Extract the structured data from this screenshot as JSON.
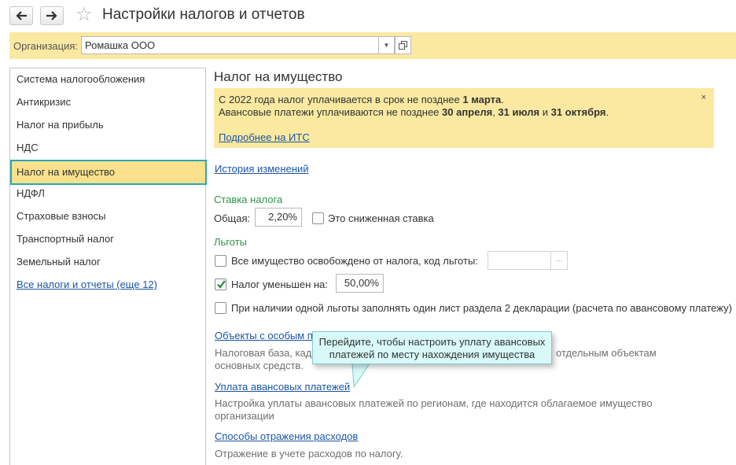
{
  "window": {
    "title": "Настройки налогов и отчетов",
    "back_icon": "arrow-left-icon",
    "forward_icon": "arrow-right-icon",
    "favorite_icon": "star-icon"
  },
  "organization": {
    "label": "Организация:",
    "value": "Ромашка ООО"
  },
  "sidebar": {
    "items": [
      {
        "label": "Система налогообложения"
      },
      {
        "label": "Антикризис"
      },
      {
        "label": "Налог на прибыль"
      },
      {
        "label": "НДС"
      },
      {
        "label": "Налог на имущество",
        "selected": true
      },
      {
        "label": "НДФЛ"
      },
      {
        "label": "Страховые взносы"
      },
      {
        "label": "Транспортный налог"
      },
      {
        "label": "Земельный налог"
      }
    ],
    "all_link": "Все налоги и отчеты (еще 12)"
  },
  "main": {
    "title": "Налог на имущество",
    "notice": {
      "line1_prefix": "С 2022 года налог уплачивается в срок не позднее ",
      "line1_bold": "1 марта",
      "line1_suffix": ".",
      "line2_prefix": "Авансовые платежи уплачиваются не позднее ",
      "date1": "30 апреля",
      "sep1": ", ",
      "date2": "31 июля",
      "sep2": " и ",
      "date3": "31 октября",
      "line2_suffix": ".",
      "link": "Подробнее на ИТС",
      "close": "×"
    },
    "history_link": "История изменений",
    "rate": {
      "section_title": "Ставка налога",
      "general_label": "Общая:",
      "general_value": "2,20%",
      "reduced_label": "Это сниженная ставка",
      "reduced_checked": false
    },
    "benefits": {
      "section_title": "Льготы",
      "exempt_label": "Все имущество освобождено от налога, код льготы:",
      "exempt_checked": false,
      "exempt_code": "",
      "select_button": "...",
      "reduced_label": "Налог уменьшен на:",
      "reduced_checked": true,
      "reduced_value": "50,00%",
      "single_sheet_label": "При наличии одной льготы заполнять один лист раздела 2 декларации (расчета по авансовому платежу)",
      "single_sheet_checked": false
    },
    "special_objects": {
      "link": "Объекты с особым п",
      "desc1_a": "Налоговая база, кад",
      "desc1_b": "отдельным объектам",
      "desc2": "основных средств."
    },
    "advance": {
      "link": "Уплата авансовых платежей",
      "desc1": "Настройка уплаты авансовых платежей по регионам, где находится облагаемое имущество",
      "desc2": "организации"
    },
    "expenses": {
      "link": "Способы отражения расходов",
      "desc": "Отражение в учете расходов по налогу."
    }
  },
  "tooltip": {
    "line1": "Перейдите, чтобы настроить уплату авансовых",
    "line2": "платежей по месту нахождения имущества"
  },
  "colors": {
    "notice_bg": "#fbe9a1",
    "selected_bg": "#fbe18b",
    "selected_border": "#2aa6b8",
    "link": "#1a56a6",
    "section_green": "#2e9448",
    "tooltip_bg": "#d9f9f9"
  }
}
